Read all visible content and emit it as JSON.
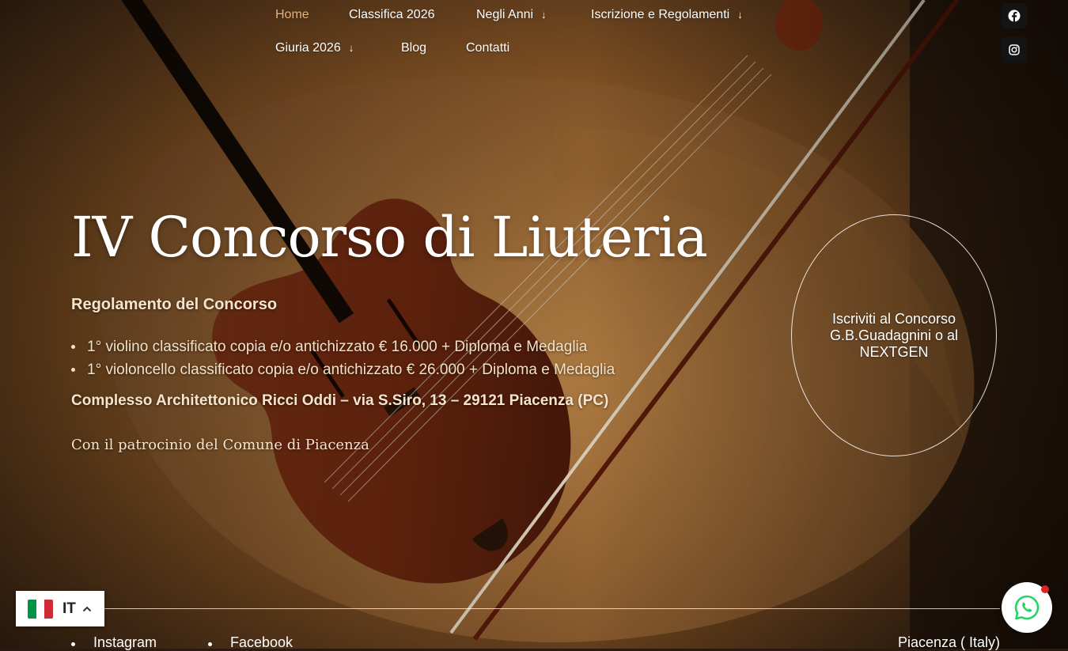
{
  "nav": {
    "items": [
      {
        "label": "Home",
        "active": true
      },
      {
        "label": "Classifica 2026"
      },
      {
        "label": "Negli Anni",
        "has_dropdown": true
      },
      {
        "label": "Iscrizione e Regolamenti",
        "has_dropdown": true
      },
      {
        "label": "Giuria 2026",
        "has_dropdown": true
      },
      {
        "label": "Blog"
      },
      {
        "label": "Contatti"
      }
    ],
    "dropdown_arrow": "↓",
    "active_color": "#e9b47d"
  },
  "social": {
    "icons": [
      "facebook-icon",
      "instagram-icon"
    ]
  },
  "hero": {
    "title": "IV Concorso di Liuteria",
    "regulation_heading": "Regolamento del Concorso",
    "prizes": [
      "1° violino classificato copia e/o antichizzato € 16.000 + Diploma e Medaglia",
      "1° violoncello classificato copia e/o antichizzato € 26.000 + Diploma e Medaglia"
    ],
    "address": "Complesso Architettonico Ricci Oddi – via S.Siro, 13 – 29121 Piacenza (PC)",
    "patronage": "Con il patrocinio del Comune di Piacenza"
  },
  "cta": {
    "label": "Iscriviti al Concorso G.B.Guadagnini o al NEXTGEN"
  },
  "language": {
    "code": "IT",
    "flag_colors": [
      "#009246",
      "#ffffff",
      "#ce2b37"
    ]
  },
  "footer": {
    "links": [
      "Instagram",
      "Facebook"
    ],
    "location": "Piacenza ( Italy)"
  },
  "whatsapp": {
    "icon": "whatsapp-icon",
    "badge_color": "#e02525",
    "brand_color": "#25d366"
  }
}
